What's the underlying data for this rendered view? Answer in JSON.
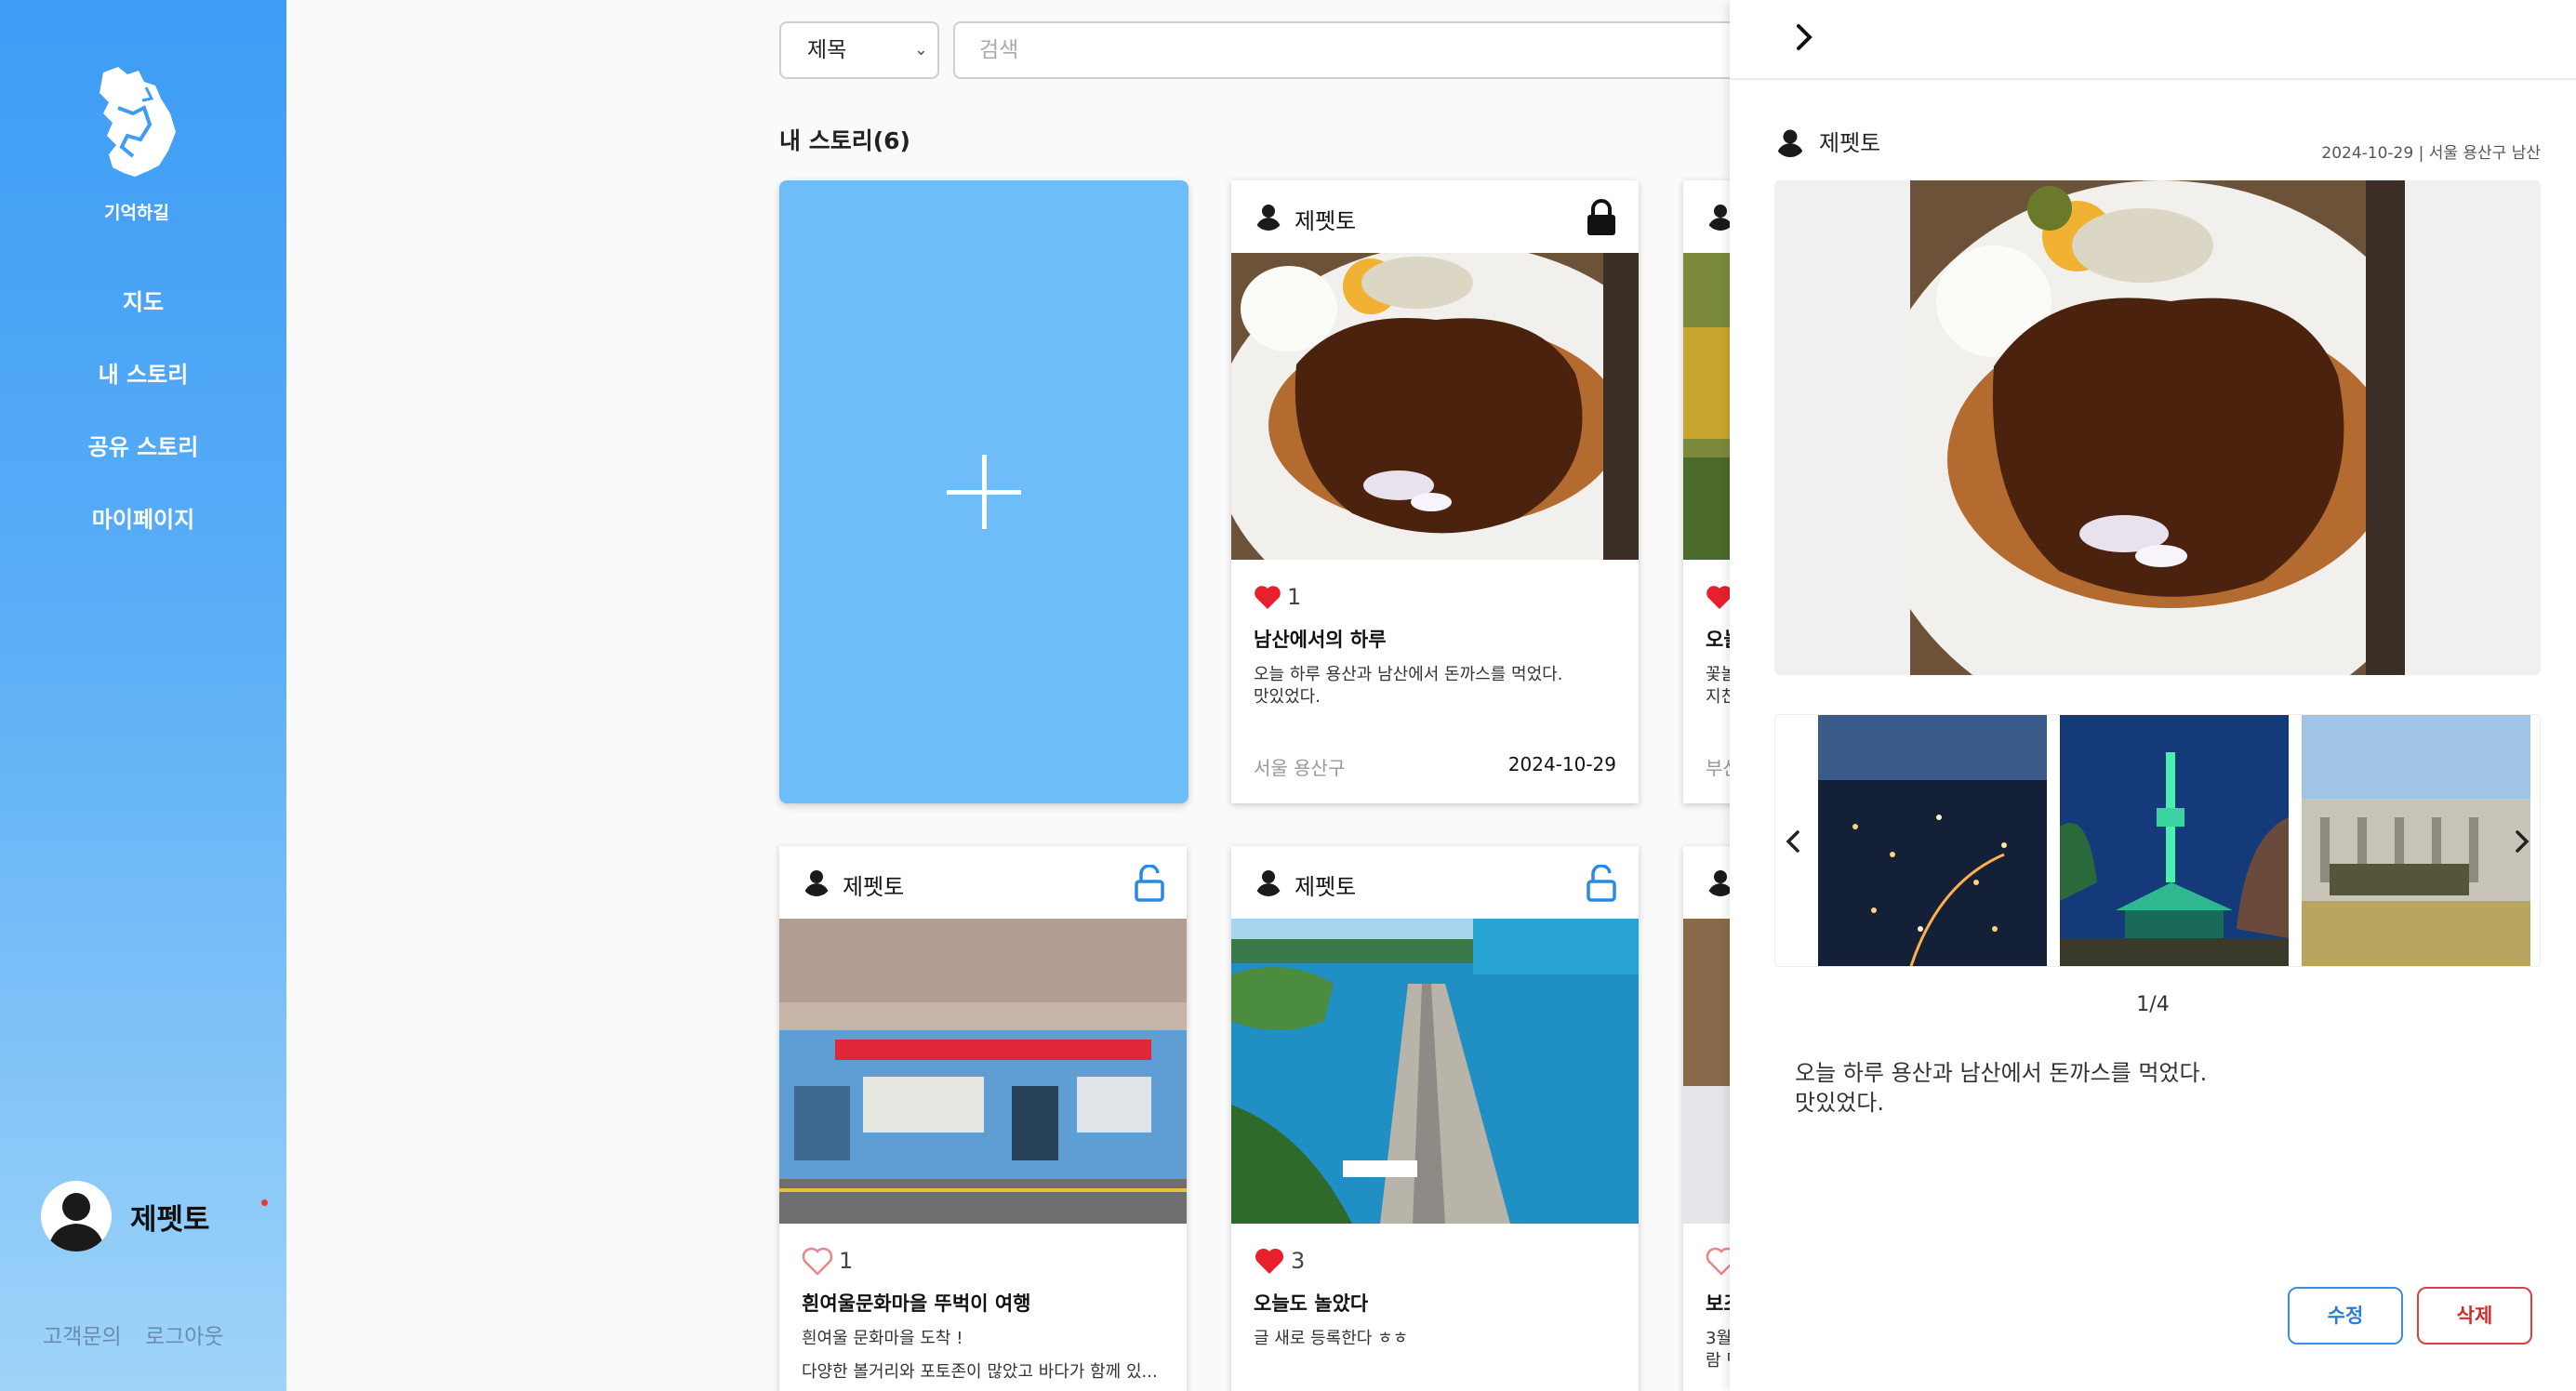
{
  "sidebar": {
    "logo_text": "기억하길",
    "nav": [
      "지도",
      "내 스토리",
      "공유 스토리",
      "마이페이지"
    ],
    "user_name": "제펫토",
    "links": [
      "고객문의",
      "로그아웃"
    ]
  },
  "search": {
    "filter_value": "제목",
    "placeholder": "검색"
  },
  "section_title": "내 스토리(6)",
  "cards": [
    {
      "author": "제펫토",
      "locked": true,
      "liked": true,
      "likes": "1",
      "title": "남산에서의 하루",
      "text_line1": "오늘 하루 용산과 남산에서 돈까스를 먹었다.",
      "text_line2": "맛있었다.",
      "location": "서울 용산구",
      "date": "2024-10-29"
    },
    {
      "author": "제펫토",
      "locked": false,
      "liked": false,
      "likes": "1",
      "title": "흰여울문화마을 뚜벅이 여행",
      "text_line1": "흰여울 문화마을 도착 !",
      "text_line2": "다양한 볼거리와 포토존이 많았고 바다가 함께 있..."
    },
    {
      "author": "제펫토",
      "locked": false,
      "liked": true,
      "likes": "3",
      "title": "오늘도 놀았다",
      "text_line1": "글 새로 등록한다 ㅎㅎ"
    }
  ],
  "partial_cards": {
    "top": {
      "title_fragment": "오늘",
      "text_fragment1": "꽃놀",
      "text_fragment2": "지친",
      "loc_fragment": "부산"
    },
    "bottom": {
      "title_fragment": "보조",
      "text_fragment1": "3월",
      "text_fragment2": "람 던"
    }
  },
  "panel": {
    "author": "제펫토",
    "meta": "2024-10-29 | 서울 용산구 남산",
    "counter": "1/4",
    "description_line1": "오늘 하루 용산과 남산에서 돈까스를 먹었다.",
    "description_line2": "맛있었다.",
    "edit_label": "수정",
    "delete_label": "삭제"
  },
  "colors": {
    "sidebar_top": "#3d9cf5",
    "sidebar_bottom": "#9fd4f9",
    "add_card": "#6fbdf8",
    "heart": "#e8202e",
    "edit_border": "#3a8fe0",
    "delete_border": "#d94040"
  }
}
